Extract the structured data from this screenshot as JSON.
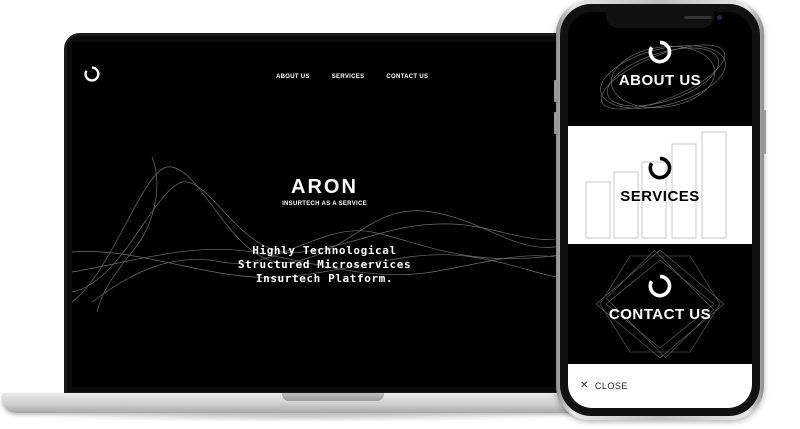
{
  "site": {
    "nav": [
      "ABOUT US",
      "SERVICES",
      "CONTACT US"
    ],
    "brand": "ARON",
    "tagline": "INSURTECH AS A SERVICE",
    "hero_lines": [
      "Highly Technological",
      "Structured Microservices",
      "Insurtech Platform."
    ]
  },
  "mobile_menu": {
    "items": [
      "ABOUT US",
      "SERVICES",
      "CONTACT US"
    ],
    "close_label": "CLOSE"
  },
  "colors": {
    "background": "#000000",
    "foreground": "#ffffff",
    "services_bg": "#ffffff"
  },
  "icons": [
    "logo-ring-icon",
    "close-icon"
  ]
}
